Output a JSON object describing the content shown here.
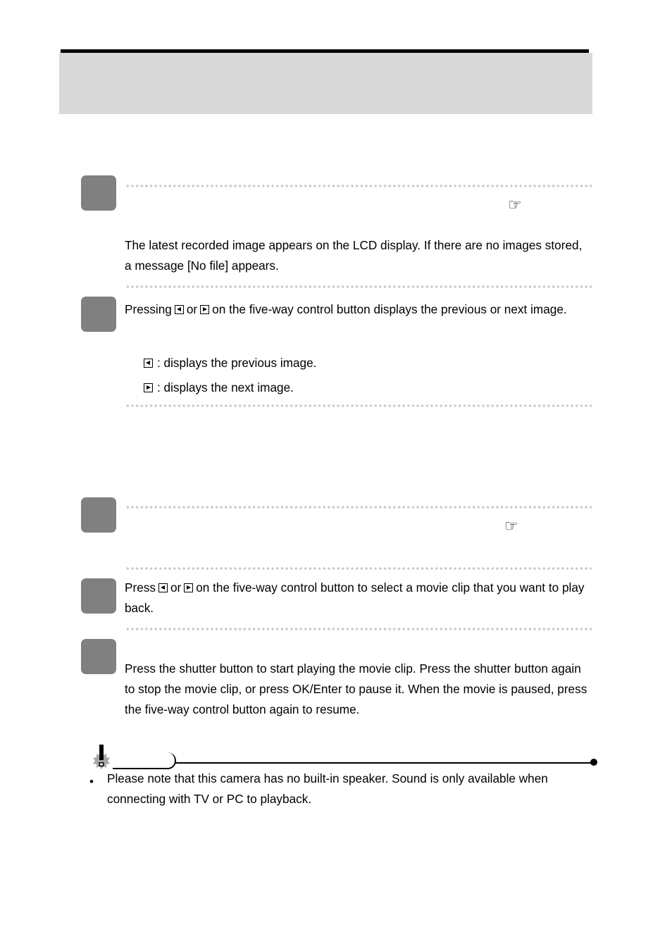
{
  "header": {
    "title": ""
  },
  "section_image_playback": {
    "step1": {
      "title": "",
      "text": "The latest recorded image appears on the LCD display. If there are no images stored, a message [No file] appears."
    },
    "step2": {
      "text_before": "Pressing",
      "text_or": "or",
      "text_after": "on the five-way control button displays the previous or next image.",
      "items": [
        {
          "icon": "left-arrow-button-icon",
          "label": ": displays the previous image."
        },
        {
          "icon": "right-arrow-button-icon",
          "label": ": displays the next image."
        }
      ]
    }
  },
  "section_movie_playback": {
    "step1": {
      "title": ""
    },
    "step2": {
      "text_before": "Press",
      "text_or": "or",
      "text_after": "on the five-way control button to select a movie clip that you want to play back."
    },
    "step3": {
      "text": "Press the shutter button to start playing the movie clip. Press the shutter button again to stop the movie clip, or press OK/Enter to pause it. When the movie is paused, press the five-way control button again to resume."
    }
  },
  "note": {
    "label": "",
    "bullets": [
      "Please note that this camera has no built-in speaker. Sound is only available when connecting with TV or PC to playback."
    ]
  },
  "icons": {
    "reference": "☞",
    "bullet": "•"
  },
  "colors": {
    "header_band": "#d9d9d9",
    "step_box": "#808080",
    "dots": "#c8c8c8"
  }
}
